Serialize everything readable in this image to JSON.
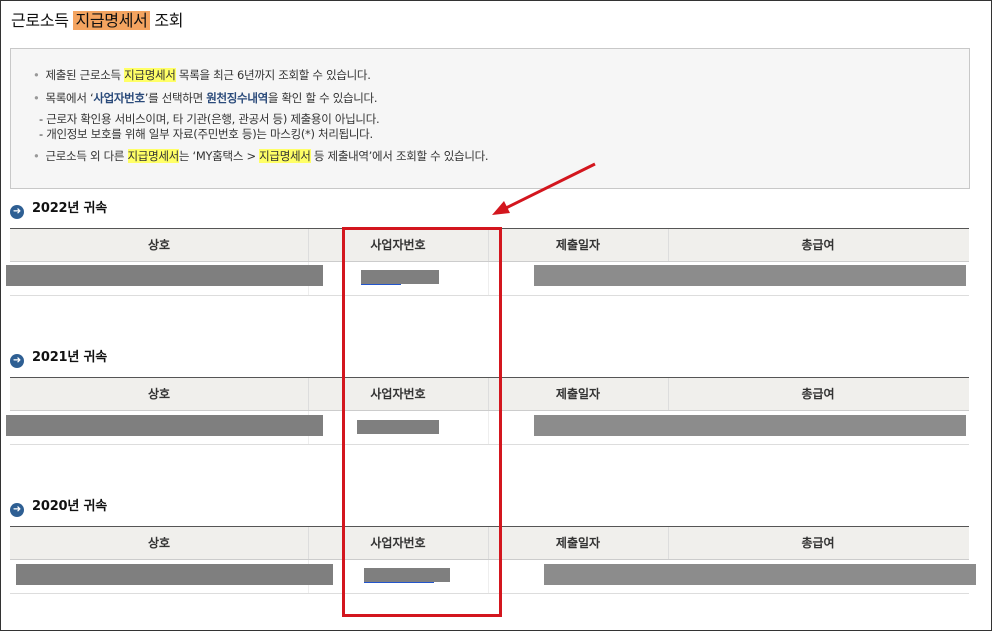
{
  "page": {
    "title_prefix": "근로소득 ",
    "title_highlight": "지급명세서",
    "title_suffix": " 조회"
  },
  "notice": {
    "line1": {
      "a": "제출된 근로소득 ",
      "hl": "지급명세서",
      "b": " 목록을 최근 6년까지 조회할 수 있습니다."
    },
    "line2": {
      "a": "목록에서 ‘",
      "strong1": "사업자번호",
      "b": "’를 선택하면 ",
      "strong2": "원천징수내역",
      "c": "을 확인 할 수 있습니다."
    },
    "sub1": "- 근로자 확인용 서비스이며, 타 기관(은행, 관공서 등) 제출용이 아닙니다.",
    "sub2": "- 개인정보 보호를 위해 일부 자료(주민번호 등)는 마스킹(*) 처리됩니다.",
    "line3": {
      "a": "근로소득 외 다른 ",
      "hl1": "지급명세서",
      "b": "는 ‘MY홈택스 > ",
      "hl2": "지급명세서",
      "c": " 등 제출내역’에서 조회할 수 있습니다."
    }
  },
  "columns": [
    "상호",
    "사업자번호",
    "제출일자",
    "총급여"
  ],
  "sections": [
    {
      "title": "2022년 귀속"
    },
    {
      "title": "2021년 귀속"
    },
    {
      "title": "2020년 귀속"
    }
  ],
  "colors": {
    "accent_red": "#d3161e",
    "highlight_orange": "#f4a460",
    "highlight_yellow": "#ffff66",
    "icon_blue": "#2e5f93"
  }
}
